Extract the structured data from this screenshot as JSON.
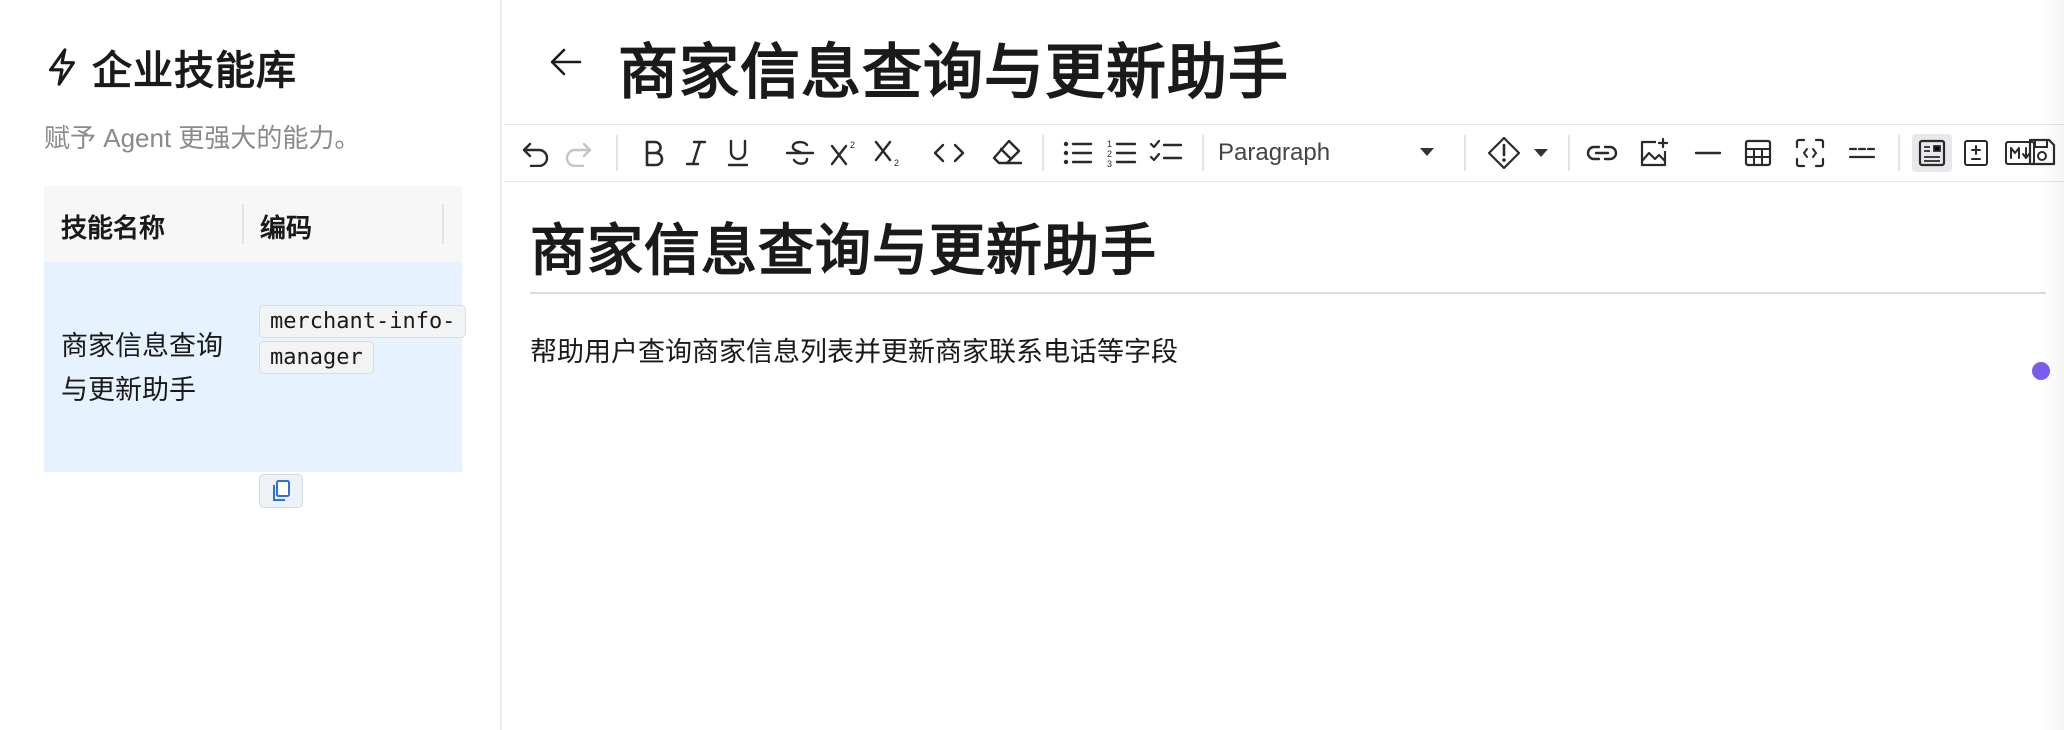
{
  "sidebar": {
    "title": "企业技能库",
    "description": "赋予 Agent 更强大的能力。",
    "table": {
      "headers": [
        "技能名称",
        "编码"
      ],
      "rows": [
        {
          "name": "商家信息查询与更新助手",
          "code": "merchant-info-manager"
        }
      ]
    }
  },
  "main": {
    "title": "商家信息查询与更新助手",
    "toolbar": {
      "paragraph_select": "Paragraph",
      "icons": [
        "undo-icon",
        "redo-icon",
        "bold-icon",
        "italic-icon",
        "underline-icon",
        "strikethrough-icon",
        "superscript-icon",
        "subscript-icon",
        "code-icon",
        "clear-format-icon",
        "bullet-list-icon",
        "ordered-list-icon",
        "task-list-icon",
        "callout-icon",
        "link-icon",
        "image-icon",
        "horizontal-rule-icon",
        "table-icon",
        "fullscreen-icon",
        "divider-icon",
        "preview-mode-icon",
        "diff-icon",
        "markdown-icon",
        "save-icon"
      ]
    },
    "document": {
      "heading": "商家信息查询与更新助手",
      "paragraph": "帮助用户查询商家信息列表并更新商家联系电话等字段"
    }
  },
  "colors": {
    "selected_row": "#e6f2fd",
    "accent_dot": "#7b5cf0"
  }
}
